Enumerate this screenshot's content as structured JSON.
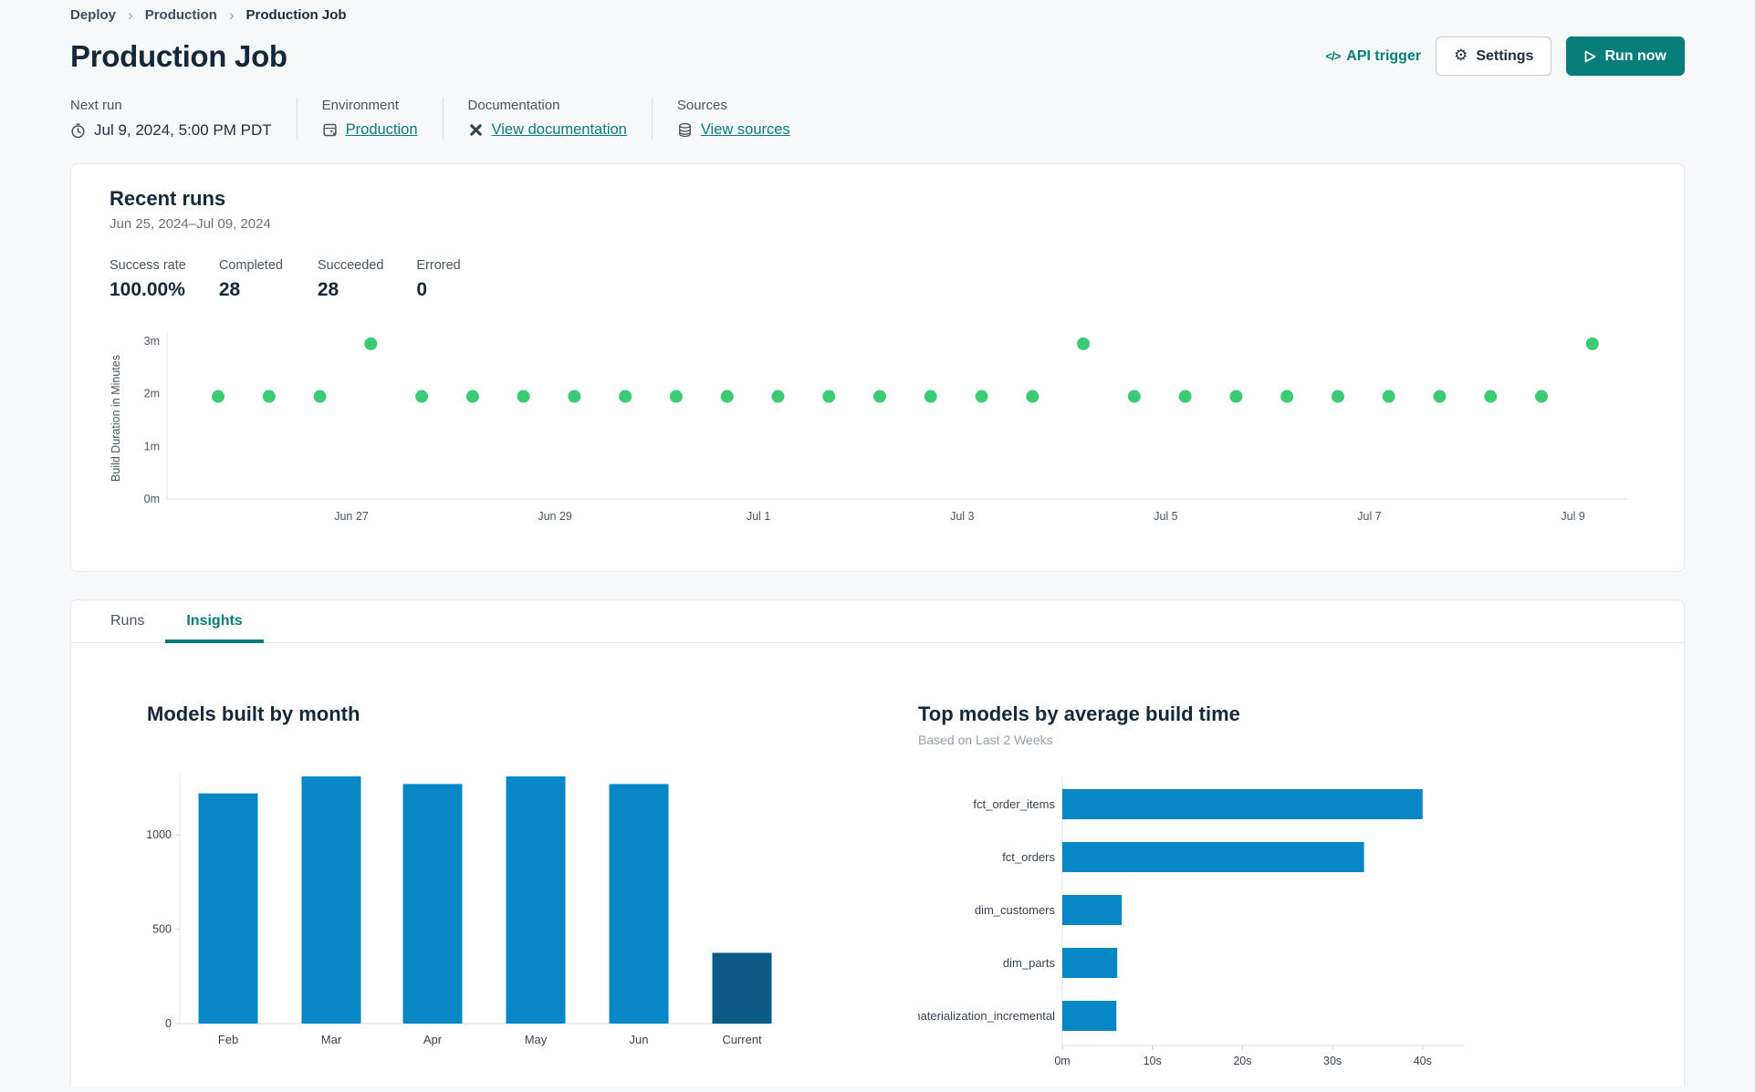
{
  "colors": {
    "accent_teal": "#077D7A",
    "run_dot_green": "#3ACB74",
    "bar_blue": "#0787C6",
    "bar_dark_blue": "#0B5A85"
  },
  "breadcrumb": {
    "items": [
      "Deploy",
      "Production",
      "Production Job"
    ]
  },
  "header": {
    "title": "Production Job",
    "api_trigger": "API trigger",
    "settings": "Settings",
    "run_now": "Run now"
  },
  "info": {
    "next_run": {
      "label": "Next run",
      "value": "Jul 9, 2024, 5:00 PM PDT"
    },
    "environment": {
      "label": "Environment",
      "value": "Production"
    },
    "documentation": {
      "label": "Documentation",
      "value": "View documentation"
    },
    "sources": {
      "label": "Sources",
      "value": "View sources"
    }
  },
  "recent_runs": {
    "title": "Recent runs",
    "date_range": "Jun 25, 2024–Jul 09, 2024",
    "stats": [
      {
        "label": "Success rate",
        "value": "100.00%"
      },
      {
        "label": "Completed",
        "value": "28"
      },
      {
        "label": "Succeeded",
        "value": "28"
      },
      {
        "label": "Errored",
        "value": "0"
      }
    ]
  },
  "tabs": {
    "runs": "Runs",
    "insights": "Insights"
  },
  "chart_data": [
    {
      "type": "scatter",
      "ylabel": "Build Duration in Minutes",
      "ytick_labels": [
        "0m",
        "1m",
        "2m",
        "3m"
      ],
      "ylim_minutes": [
        0,
        3.3
      ],
      "xtick_labels": [
        "Jun 27",
        "Jun 29",
        "Jul 1",
        "Jul 3",
        "Jul 5",
        "Jul 7",
        "Jul 9"
      ],
      "points_minutes": [
        1.95,
        1.95,
        1.95,
        2.95,
        1.95,
        1.95,
        1.95,
        1.95,
        1.95,
        1.95,
        1.95,
        1.95,
        1.95,
        1.95,
        1.95,
        1.95,
        1.95,
        2.95,
        1.95,
        1.95,
        1.95,
        1.95,
        1.95,
        1.95,
        1.95,
        1.95,
        1.95,
        2.95
      ],
      "point_color": "#3ACB74",
      "grid": false,
      "legend": "none"
    },
    {
      "type": "bar",
      "title": "Models built by month",
      "categories": [
        "Feb",
        "Mar",
        "Apr",
        "May",
        "Jun",
        "Current"
      ],
      "values": [
        1220,
        1310,
        1270,
        1310,
        1270,
        375
      ],
      "bar_colors": [
        "#0787C6",
        "#0787C6",
        "#0787C6",
        "#0787C6",
        "#0787C6",
        "#0B5A85"
      ],
      "ytick_values": [
        0,
        500,
        1000
      ],
      "ylim": [
        0,
        1320
      ],
      "xlabel": "",
      "ylabel": "",
      "grid": false
    },
    {
      "type": "bar-horizontal",
      "title": "Top models by average build time",
      "subtitle": "Based on Last 2 Weeks",
      "categories": [
        "fct_order_items",
        "fct_orders",
        "dim_customers",
        "dim_parts",
        "materialization_incremental"
      ],
      "values_seconds": [
        40,
        33.5,
        6.6,
        6.1,
        6
      ],
      "xtick_values": [
        0,
        10,
        20,
        30,
        40
      ],
      "xtick_labels": [
        "0m",
        "10s",
        "20s",
        "30s",
        "40s"
      ],
      "xlim_seconds": [
        0,
        44.5
      ],
      "bar_color": "#0787C6",
      "grid": false
    }
  ]
}
